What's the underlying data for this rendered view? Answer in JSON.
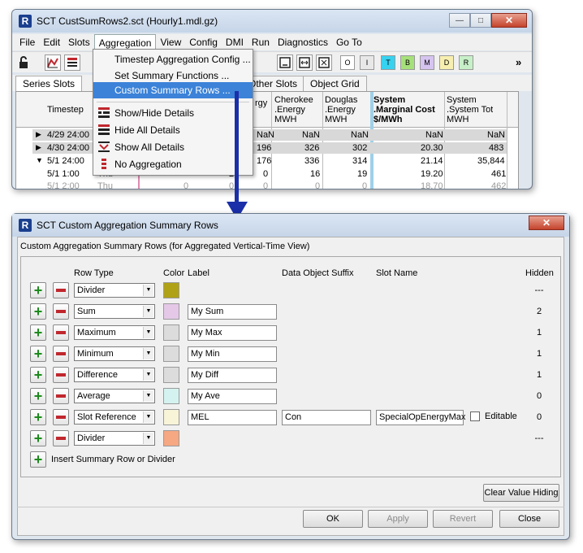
{
  "main_window": {
    "title": "SCT CustSumRows2.sct (Hourly1.mdl.gz)",
    "app_icon_letter": "R",
    "menu": [
      "File",
      "Edit",
      "Slots",
      "Aggregation",
      "View",
      "Config",
      "DMI",
      "Run",
      "Diagnostics",
      "Go To"
    ],
    "toolbar": {
      "color_buttons": [
        {
          "label": "O",
          "color": "#ffffff"
        },
        {
          "label": "I",
          "color": "#e8e8e8"
        },
        {
          "label": "T",
          "color": "#36d2f0"
        },
        {
          "label": "B",
          "color": "#a6e07a"
        },
        {
          "label": "M",
          "color": "#d6c4f0"
        },
        {
          "label": "D",
          "color": "#f7efb0"
        },
        {
          "label": "R",
          "color": "#c8f0c8"
        }
      ],
      "overflow": "»"
    },
    "tabs": [
      "Series Slots",
      "Other Slots",
      "Object Grid"
    ],
    "grid": {
      "timestep_header": "Timestep",
      "columns": [
        {
          "lines": [
            "",
            "rgy"
          ]
        },
        {
          "lines": [
            "Cherokee",
            ".Energy",
            "MWH"
          ]
        },
        {
          "lines": [
            "Douglas",
            ".Energy",
            "MWH"
          ]
        },
        {
          "lines": [
            "System",
            ".Marginal Cost",
            "$/MWh"
          ]
        },
        {
          "lines": [
            "System",
            ".System Tot",
            "MWH"
          ]
        }
      ],
      "rows": [
        {
          "arrow": "▶",
          "time": "4/29 24:00",
          "c1": "NaN",
          "c2": "NaN",
          "c3": "NaN",
          "c4": "NaN",
          "c5": "NaN"
        },
        {
          "arrow": "▶",
          "time": "4/30 24:00",
          "c1": "196",
          "c2": "326",
          "c3": "302",
          "c4": "20.30",
          "c5": "483"
        },
        {
          "arrow": "▼",
          "time": "5/1 24:00",
          "c1": "176",
          "c2": "336",
          "c3": "314",
          "c4": "21.14",
          "c5": "35,844"
        },
        {
          "arrow": "",
          "time": "5/1 1:00",
          "c1": "0",
          "c2": "16",
          "c3": "19",
          "c4": "19.20",
          "c5": "461"
        },
        {
          "arrow": "",
          "time": "5/1 2:00",
          "c1": "0",
          "c2": "0",
          "c3": "0",
          "c4": "18.70",
          "c5": "462"
        }
      ],
      "partial_cells": [
        "Thu",
        "0",
        "2",
        "0"
      ]
    }
  },
  "aggregation_menu": {
    "items": [
      "Timestep Aggregation Config ...",
      "Set Summary Functions ...",
      "Custom Summary Rows ...",
      "Show/Hide Details",
      "Hide All Details",
      "Show All Details",
      "No Aggregation"
    ]
  },
  "dialog": {
    "title": "SCT Custom Aggregation Summary Rows",
    "subtitle": "Custom Aggregation Summary Rows (for Aggregated Vertical-Time View)",
    "headers": {
      "row_type": "Row Type",
      "color": "Color",
      "label": "Label",
      "suffix": "Data Object Suffix",
      "slot_name": "Slot Name",
      "hidden": "Hidden"
    },
    "rows": [
      {
        "type": "Divider",
        "color": "#b0a217",
        "label": "",
        "suffix": "",
        "slot": "",
        "hidden": "---"
      },
      {
        "type": "Sum",
        "color": "#e5c8e8",
        "label": "My Sum",
        "suffix": "",
        "slot": "",
        "hidden": "2"
      },
      {
        "type": "Maximum",
        "color": "#dcdcdc",
        "label": "My Max",
        "suffix": "",
        "slot": "",
        "hidden": "1"
      },
      {
        "type": "Minimum",
        "color": "#dcdcdc",
        "label": "My Min",
        "suffix": "",
        "slot": "",
        "hidden": "1"
      },
      {
        "type": "Difference",
        "color": "#dcdcdc",
        "label": "My Diff",
        "suffix": "",
        "slot": "",
        "hidden": "1"
      },
      {
        "type": "Average",
        "color": "#d4f3f0",
        "label": "My Ave",
        "suffix": "",
        "slot": "",
        "hidden": "0"
      },
      {
        "type": "Slot Reference",
        "color": "#f8f4d8",
        "label": "MEL",
        "suffix": "Con",
        "slot": "SpecialOpEnergyMax",
        "hidden": "0",
        "editable_label": "Editable"
      },
      {
        "type": "Divider",
        "color": "#f5a882",
        "label": "",
        "suffix": "",
        "slot": "",
        "hidden": "---"
      }
    ],
    "insert_label": "Insert Summary Row or Divider",
    "buttons": {
      "clear": "Clear Value Hiding",
      "ok": "OK",
      "apply": "Apply",
      "revert": "Revert",
      "close": "Close"
    }
  }
}
